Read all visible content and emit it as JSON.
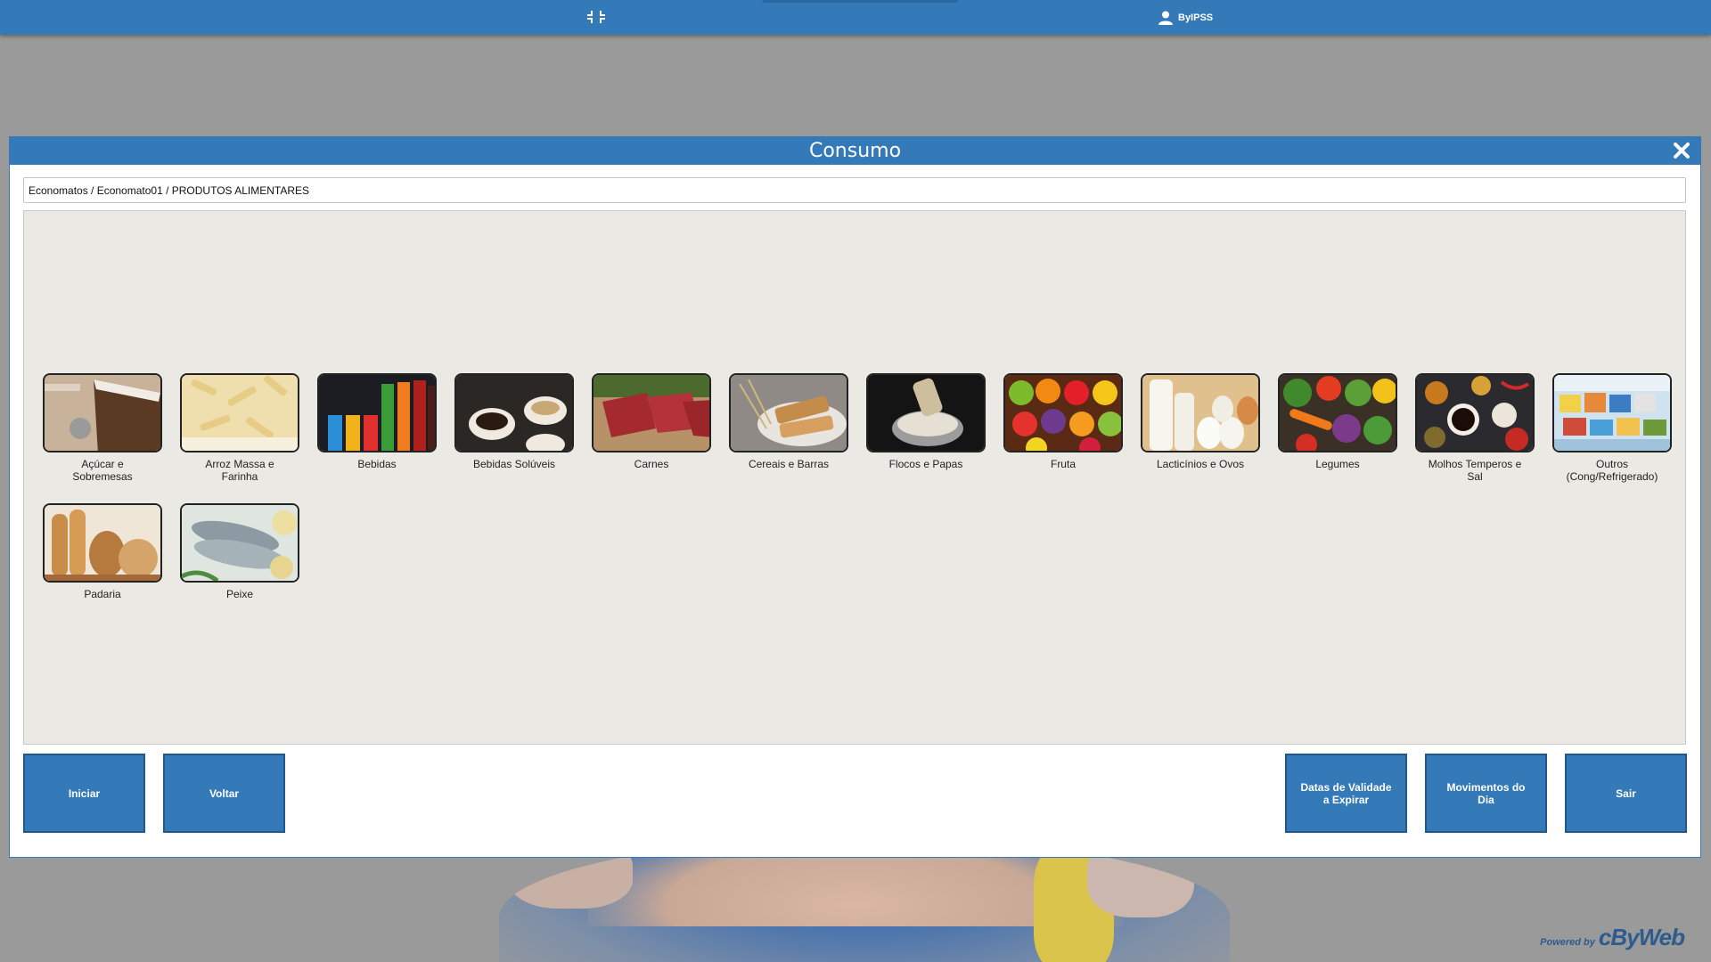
{
  "topbar": {
    "user_label": "ByIPSS",
    "colors": {
      "bar": "#3479b8"
    }
  },
  "modal": {
    "title": "Consumo",
    "breadcrumb": "Economatos / Economato01 / PRODUTOS ALIMENTARES"
  },
  "categories": [
    {
      "label": "Açúcar e Sobremesas",
      "icon": "dessert-image"
    },
    {
      "label": "Arroz Massa e Farinha",
      "icon": "pasta-image"
    },
    {
      "label": "Bebidas",
      "icon": "drinks-image"
    },
    {
      "label": "Bebidas Solúveis",
      "icon": "coffee-image"
    },
    {
      "label": "Carnes",
      "icon": "meat-image"
    },
    {
      "label": "Cereais e Barras",
      "icon": "cereal-bars-image"
    },
    {
      "label": "Flocos e Papas",
      "icon": "oat-flakes-image"
    },
    {
      "label": "Fruta",
      "icon": "fruit-image"
    },
    {
      "label": "Lacticínios e Ovos",
      "icon": "dairy-eggs-image"
    },
    {
      "label": "Legumes",
      "icon": "vegetables-image"
    },
    {
      "label": "Molhos Temperos e Sal",
      "icon": "sauces-spices-image"
    },
    {
      "label": "Outros (Cong/Refrigerado)",
      "icon": "frozen-image"
    },
    {
      "label": "Padaria",
      "icon": "bread-image"
    },
    {
      "label": "Peixe",
      "icon": "fish-image"
    }
  ],
  "buttons": {
    "start": "Iniciar",
    "back": "Voltar",
    "expiry": "Datas de Validade a Expirar",
    "day_moves": "Movimentos do Dia",
    "exit": "Sair"
  },
  "footer": {
    "powered_small": "Powered by",
    "powered_logo": "cByWeb"
  }
}
